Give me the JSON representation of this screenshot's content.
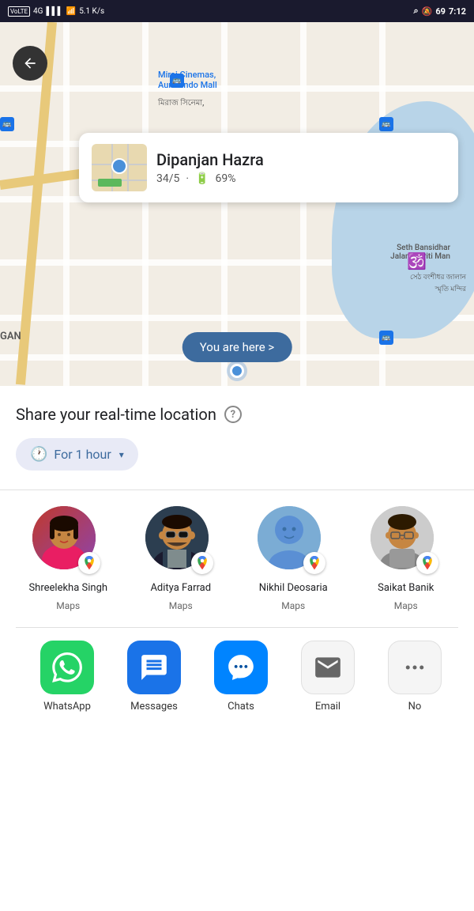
{
  "statusBar": {
    "left": [
      "VoLTE",
      "4G",
      "signal",
      "wifi",
      "5.1 K/s"
    ],
    "right": [
      "location-icon",
      "bell-muted-icon",
      "69",
      "7:12"
    ]
  },
  "map": {
    "backButton": "←",
    "infoCard": {
      "name": "Dipanjan Hazra",
      "rating": "34/5",
      "battery": "69%"
    },
    "youAreHere": "You are here >",
    "mapLabel1": "Miraj Cinemas,\nAurobindo Mall",
    "mapLabel2": "মিরাজ সিনেমা,",
    "mapLabel3": "Seth Bansidhar\nJalan Smriti Man",
    "mapLabel4": "সেঠ বংশীধর জালান\nস্মৃতি মন্দির"
  },
  "bottomSheet": {
    "shareTitle": "Share your real-time location",
    "helpIcon": "?",
    "durationLabel": "For 1 hour",
    "durationChevron": "▾"
  },
  "contacts": [
    {
      "name": "Shreelekha Singh",
      "app": "Maps",
      "avatarType": "shreelekha"
    },
    {
      "name": "Aditya Farrad",
      "app": "Maps",
      "avatarType": "aditya"
    },
    {
      "name": "Nikhil Deosaria",
      "app": "Maps",
      "avatarType": "nikhil"
    },
    {
      "name": "Saikat Banik",
      "app": "Maps",
      "avatarType": "saikat"
    }
  ],
  "apps": [
    {
      "name": "WhatsApp",
      "iconType": "whatsapp"
    },
    {
      "name": "Messages",
      "iconType": "messages"
    },
    {
      "name": "Chats",
      "iconType": "chats"
    },
    {
      "name": "Email",
      "iconType": "email"
    },
    {
      "name": "No",
      "iconType": "no"
    }
  ]
}
